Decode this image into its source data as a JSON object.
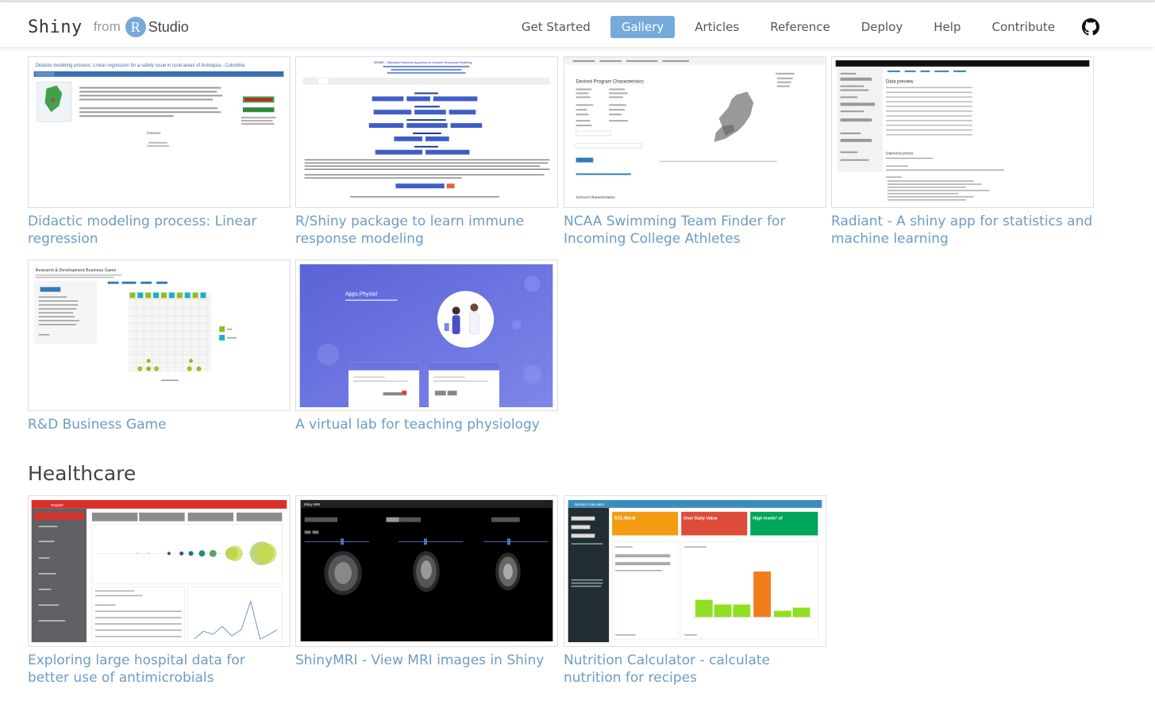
{
  "header": {
    "brand_shiny": "Shiny",
    "brand_from": "from",
    "brand_r": "R",
    "brand_studio": "Studio",
    "nav": [
      "Get Started",
      "Gallery",
      "Articles",
      "Reference",
      "Deploy",
      "Help",
      "Contribute"
    ],
    "active_nav": "Gallery",
    "github_icon": "github-icon",
    "accent_color": "#75aadb"
  },
  "sections": {
    "healthcare_title": "Healthcare"
  },
  "cards": [
    {
      "caption": "Didactic modeling process: Linear regression",
      "thumb_title": "Didactic modeling process: Linear regression for a safety issue in rural areas of Antioquia - Colombia"
    },
    {
      "caption": "R/Shiny package to learn immune response modeling",
      "thumb_title": "SIMMR - Simulated Systems Approach to Immune Response Modeling"
    },
    {
      "caption": "NCAA Swimming Team Finder for Incoming College Athletes",
      "thumb_title": "Desired Program Characteristics"
    },
    {
      "caption": "Radiant - A shiny app for statistics and machine learning",
      "thumb_title": "Data preview"
    },
    {
      "caption": "R&D Business Game",
      "thumb_title": "Research & Development Business Game"
    },
    {
      "caption": "A virtual lab for teaching physiology",
      "thumb_title": "Apps.Physiol"
    },
    {
      "caption": "Exploring large hospital data for better use of antimicrobials",
      "thumb_title": "RadaR"
    },
    {
      "caption": "ShinyMRI - View MRI images in Shiny",
      "thumb_title": "Shiny MRI"
    },
    {
      "caption": "Nutrition Calculator - calculate nutrition for recipes",
      "thumb_title": "Nutrition Calculator",
      "kcal": "513.4kcal",
      "over": "Over Daily Value",
      "high": "High levels* of"
    }
  ]
}
